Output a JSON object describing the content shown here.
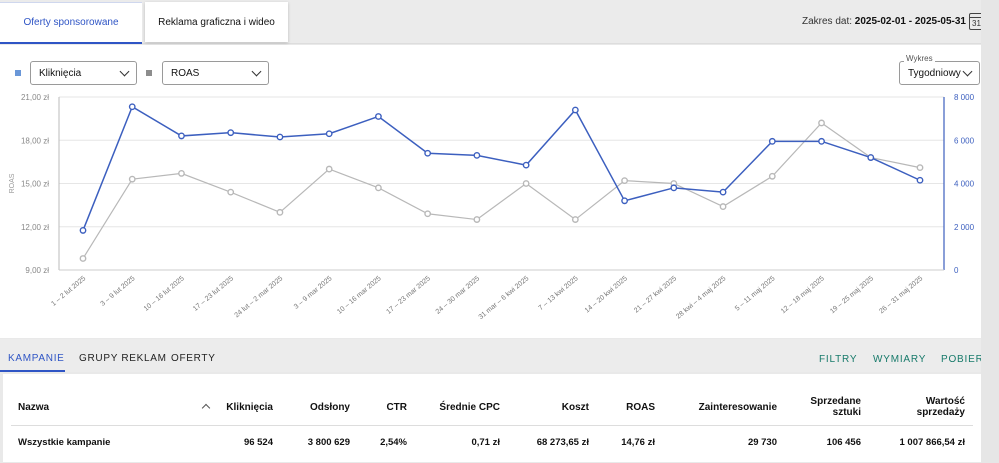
{
  "top_tabs": [
    {
      "label": "Oferty sponsorowane",
      "active": true
    },
    {
      "label": "Reklama graficzna i wideo",
      "active": false
    }
  ],
  "date_range": {
    "label": "Zakres dat:",
    "value": "2025-02-01 - 2025-05-31",
    "calendar_day": "31"
  },
  "controls": {
    "metric1": {
      "value": "Kliknięcia",
      "color": "#6a97d8"
    },
    "metric2": {
      "value": "ROAS",
      "color": "#8d8d8d"
    },
    "chart_mode": {
      "legend": "Wykres",
      "value": "Tygodniowy"
    }
  },
  "chart_data": {
    "type": "line",
    "x": [
      "1 – 2 lut 2025",
      "3 – 9 lut 2025",
      "10 – 16 lut 2025",
      "17 – 23 lut 2025",
      "24 lut – 2 mar 2025",
      "3 – 9 mar 2025",
      "10 – 16 mar 2025",
      "17 – 23 mar 2025",
      "24 – 30 mar 2025",
      "31 mar – 6 kwi 2025",
      "7 – 13 kwi 2025",
      "14 – 20 kwi 2025",
      "21 – 27 kwi 2025",
      "28 kwi – 4 maj 2025",
      "5 – 11 maj 2025",
      "12 – 18 maj 2025",
      "19 – 25 maj 2025",
      "26 – 31 maj 2025"
    ],
    "series": [
      {
        "name": "ROAS",
        "axis": "left",
        "color": "#b8b8b8",
        "values": [
          9.8,
          15.3,
          15.7,
          14.4,
          13.0,
          16.0,
          14.7,
          12.9,
          12.5,
          15.0,
          12.5,
          15.2,
          15.0,
          13.4,
          15.5,
          19.2,
          16.8,
          16.1
        ]
      },
      {
        "name": "Kliknięcia",
        "axis": "right",
        "color": "#3c5fbf",
        "values": [
          1830,
          7550,
          6200,
          6350,
          6150,
          6300,
          7100,
          5400,
          5300,
          4850,
          7400,
          3200,
          3800,
          3600,
          5950,
          5950,
          5200,
          4150
        ]
      }
    ],
    "y_left": {
      "label": "ROAS",
      "ticks": [
        "9,00 zł",
        "12,00 zł",
        "15,00 zł",
        "18,00 zł",
        "21,00 zł"
      ],
      "min": 9,
      "max": 21
    },
    "y_right": {
      "label": "Kliknięcia",
      "ticks": [
        "0",
        "2 000",
        "4 000",
        "6 000",
        "8 000"
      ],
      "min": 0,
      "max": 8000
    },
    "grid": true
  },
  "sub_tabs": [
    {
      "label": "KAMPANIE",
      "active": true
    },
    {
      "label": "GRUPY REKLAM",
      "active": false
    },
    {
      "label": "OFERTY",
      "active": false
    }
  ],
  "actions": [
    "FILTRY",
    "WYMIARY",
    "POBIERZ"
  ],
  "table": {
    "headers": [
      "Nazwa",
      "Kliknięcia",
      "Odsłony",
      "CTR",
      "Średnie CPC",
      "Koszt",
      "ROAS",
      "Zainteresowanie",
      "Sprzedane sztuki",
      "Wartość sprzedaży"
    ],
    "row": [
      "Wszystkie kampanie",
      "96 524",
      "3 800 629",
      "2,54%",
      "0,71 zł",
      "68 273,65 zł",
      "14,76 zł",
      "29 730",
      "106 456",
      "1 007 866,54 zł"
    ]
  }
}
